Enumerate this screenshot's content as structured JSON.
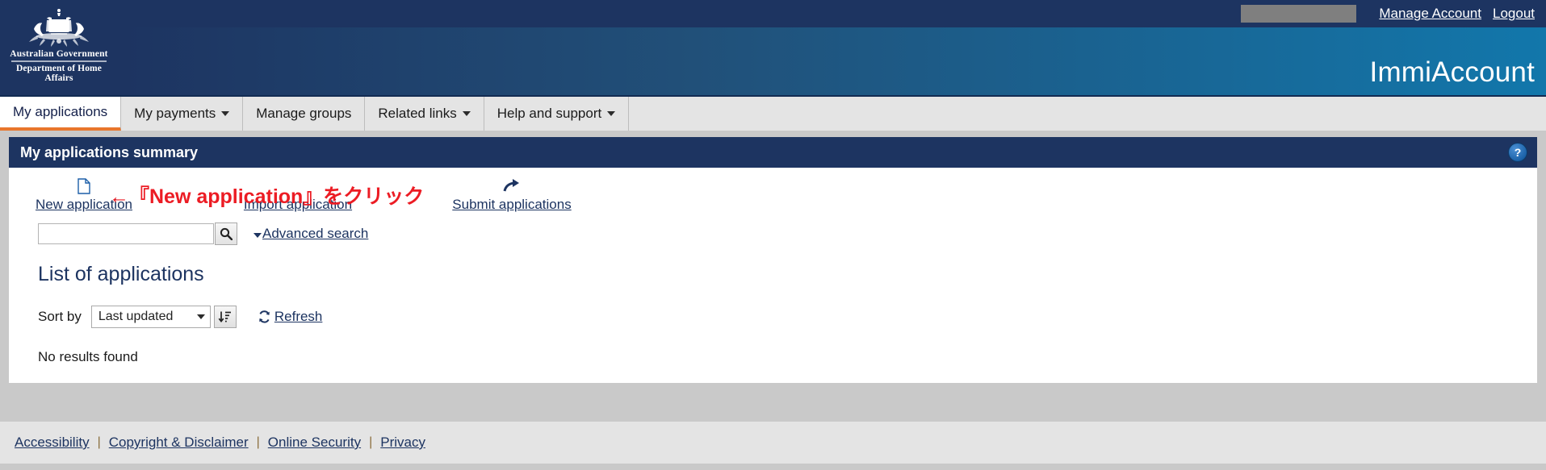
{
  "utility_bar": {
    "username_redacted": "",
    "manage_account_label": "Manage Account",
    "logout_label": "Logout"
  },
  "banner": {
    "crest_gov_line": "Australian Government",
    "crest_dept_line": "Department of Home Affairs",
    "brand_title": "ImmiAccount",
    "gradient_start": "#1d3461",
    "gradient_end": "#1277ab"
  },
  "nav": {
    "tabs": [
      {
        "label": "My applications",
        "has_caret": false,
        "active": true
      },
      {
        "label": "My payments",
        "has_caret": true,
        "active": false
      },
      {
        "label": "Manage groups",
        "has_caret": false,
        "active": false
      },
      {
        "label": "Related links",
        "has_caret": true,
        "active": false
      },
      {
        "label": "Help and support",
        "has_caret": true,
        "active": false
      }
    ],
    "active_underline_color": "#e8762c"
  },
  "panel": {
    "title": "My applications summary",
    "help_badge_label": "?",
    "header_color": "#1d3461"
  },
  "actions": {
    "new_application": {
      "label": "New application",
      "icon": "page-document-icon"
    },
    "import_application": {
      "label": "Import application",
      "icon": "none"
    },
    "submit_applications": {
      "label": "Submit applications",
      "icon": "curved-forward-arrow-icon"
    }
  },
  "annotation": {
    "text": "←『New application』をクリック",
    "color": "#ec1c24"
  },
  "search": {
    "value": "",
    "placeholder": "",
    "button_icon": "search-icon",
    "advanced_search_label": "Advanced search"
  },
  "list": {
    "heading": "List of applications",
    "sort_label": "Sort by",
    "sort_selected": "Last updated",
    "sort_options": [
      "Last updated"
    ],
    "sort_direction_icon": "sort-descending-icon",
    "refresh_label": "Refresh",
    "refresh_icon": "refresh-icon",
    "empty_message": "No results found"
  },
  "footer": {
    "links": [
      "Accessibility",
      "Copyright & Disclaimer",
      "Online Security",
      "Privacy"
    ],
    "separator": "|"
  }
}
